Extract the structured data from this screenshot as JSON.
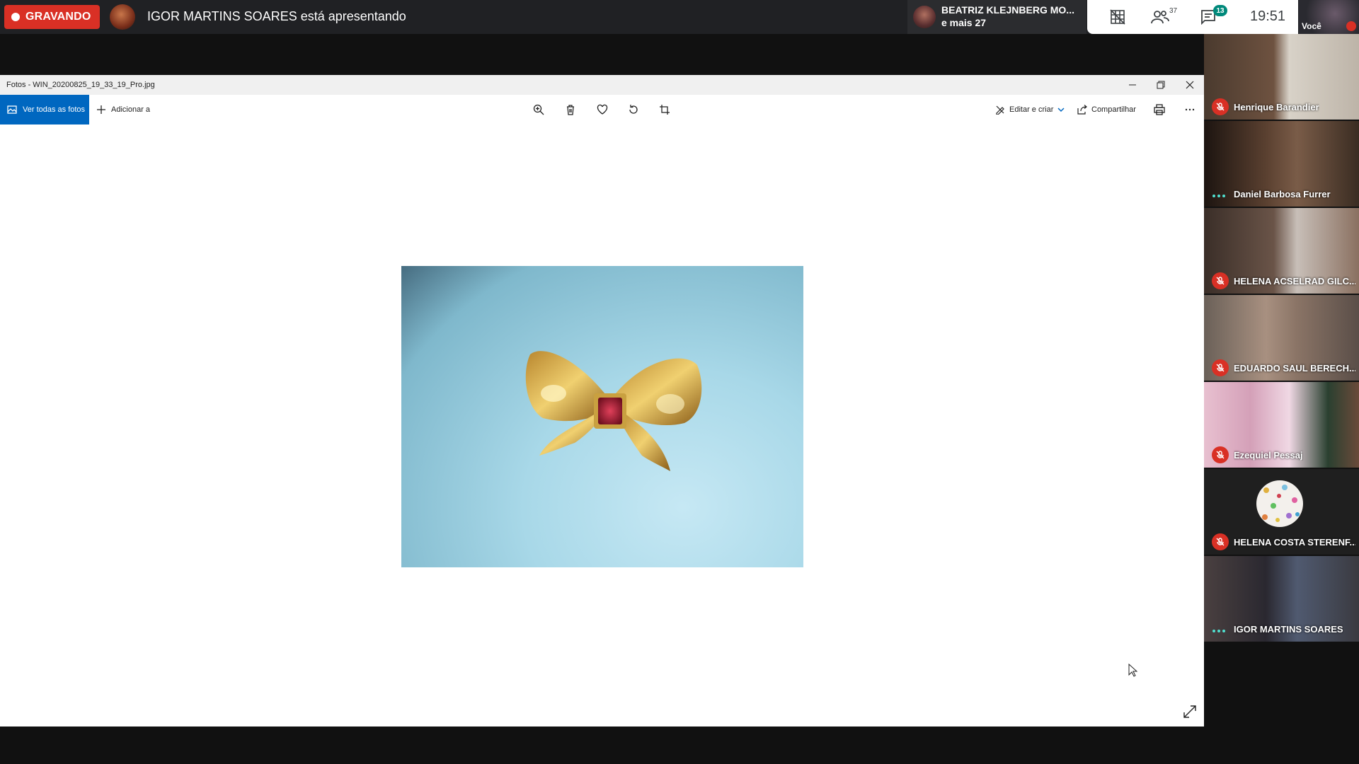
{
  "meet": {
    "recording_label": "GRAVANDO",
    "presenter_text": "IGOR MARTINS SOARES está apresentando",
    "other_presenter_name": "BEATRIZ KLEJNBERG MO...",
    "other_presenter_more": "e mais 27",
    "people_count": "37",
    "chat_count": "13",
    "clock": "19:51",
    "self_label": "Você",
    "colors": {
      "record": "#d93025",
      "accent": "#00897b"
    }
  },
  "photos_app": {
    "window_title": "Fotos - WIN_20200825_19_33_19_Pro.jpg",
    "toolbar": {
      "see_all_label": "Ver todas as fotos",
      "add_to_label": "Adicionar a",
      "edit_create_label": "Editar e criar",
      "share_label": "Compartilhar"
    },
    "icons": [
      "zoom-icon",
      "delete-icon",
      "favorite-icon",
      "rotate-icon",
      "crop-icon",
      "print-icon",
      "more-icon",
      "expand-icon"
    ]
  },
  "participants": [
    {
      "name": "Henrique Barandier",
      "state": "muted"
    },
    {
      "name": "Daniel Barbosa Furrer",
      "state": "speaking"
    },
    {
      "name": "HELENA ACSELRAD GILC...",
      "state": "muted"
    },
    {
      "name": "EDUARDO SAUL BERECH...",
      "state": "muted"
    },
    {
      "name": "Ezequiel Pessaj",
      "state": "muted"
    },
    {
      "name": "HELENA COSTA STERENF...",
      "state": "muted"
    },
    {
      "name": "IGOR MARTINS SOARES",
      "state": "speaking"
    }
  ]
}
